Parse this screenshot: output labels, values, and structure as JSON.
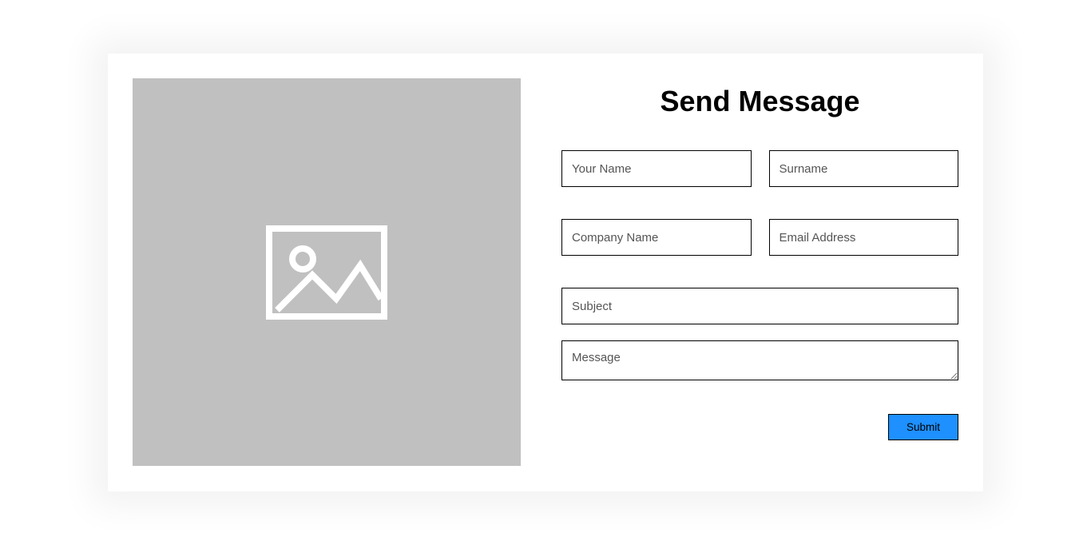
{
  "form": {
    "title": "Send Message",
    "name_placeholder": "Your Name",
    "surname_placeholder": "Surname",
    "company_placeholder": "Company Name",
    "email_placeholder": "Email Address",
    "subject_placeholder": "Subject",
    "message_placeholder": "Message",
    "submit_label": "Submit"
  }
}
